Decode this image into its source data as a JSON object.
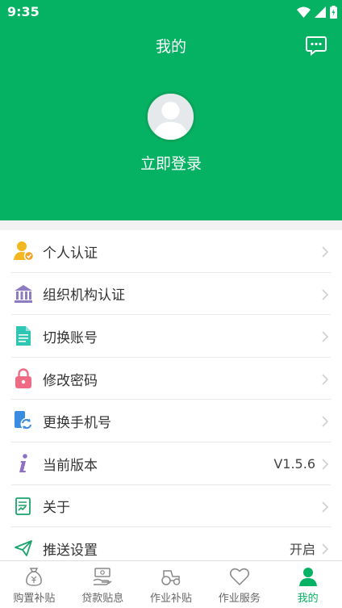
{
  "status_bar": {
    "time": "9:35"
  },
  "header": {
    "title": "我的",
    "login_text": "立即登录"
  },
  "menu": [
    {
      "label": "个人认证",
      "value": ""
    },
    {
      "label": "组织机构认证",
      "value": ""
    },
    {
      "label": "切换账号",
      "value": ""
    },
    {
      "label": "修改密码",
      "value": ""
    },
    {
      "label": "更换手机号",
      "value": ""
    },
    {
      "label": "当前版本",
      "value": "V1.5.6"
    },
    {
      "label": "关于",
      "value": ""
    },
    {
      "label": "推送设置",
      "value": "开启"
    }
  ],
  "tabs": [
    {
      "label": "购置补贴"
    },
    {
      "label": "贷款贴息"
    },
    {
      "label": "作业补贴"
    },
    {
      "label": "作业服务"
    },
    {
      "label": "我的"
    }
  ],
  "colors": {
    "brand_green": "#05b163",
    "background": "#ffffff",
    "divider": "#e8e8e8"
  }
}
